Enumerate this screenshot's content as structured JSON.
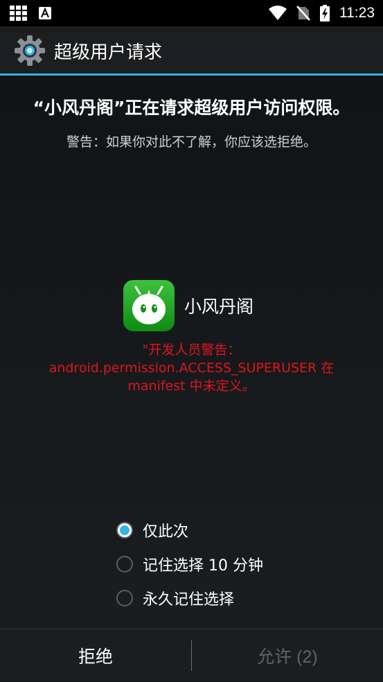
{
  "status_bar": {
    "time": "11:23",
    "icons": [
      "grid-icon",
      "text-a-icon",
      "wifi-icon",
      "no-sim-icon",
      "battery-charging-icon"
    ]
  },
  "action_bar": {
    "title": "超级用户请求",
    "icon": "gear-icon"
  },
  "request": {
    "headline": "“小风丹阁”正在请求超级用户访问权限。",
    "subline": "警告：如果你对此不了解，你应该选拒绝。"
  },
  "app": {
    "name": "小风丹阁",
    "icon": "app-robot-icon"
  },
  "developer_warning": {
    "line1": "\"开发人员警告：",
    "line2": "android.permission.ACCESS_SUPERUSER 在",
    "line3": "manifest 中未定义。"
  },
  "options": [
    {
      "label": "仅此次",
      "checked": true
    },
    {
      "label": "记住选择 10 分钟",
      "checked": false
    },
    {
      "label": "永久记住选择",
      "checked": false
    }
  ],
  "buttons": {
    "deny": "拒绝",
    "allow": "允许 (2)"
  },
  "colors": {
    "accent": "#33b5e5",
    "warning": "#e0141e",
    "app_green": "#1a9a1a"
  }
}
